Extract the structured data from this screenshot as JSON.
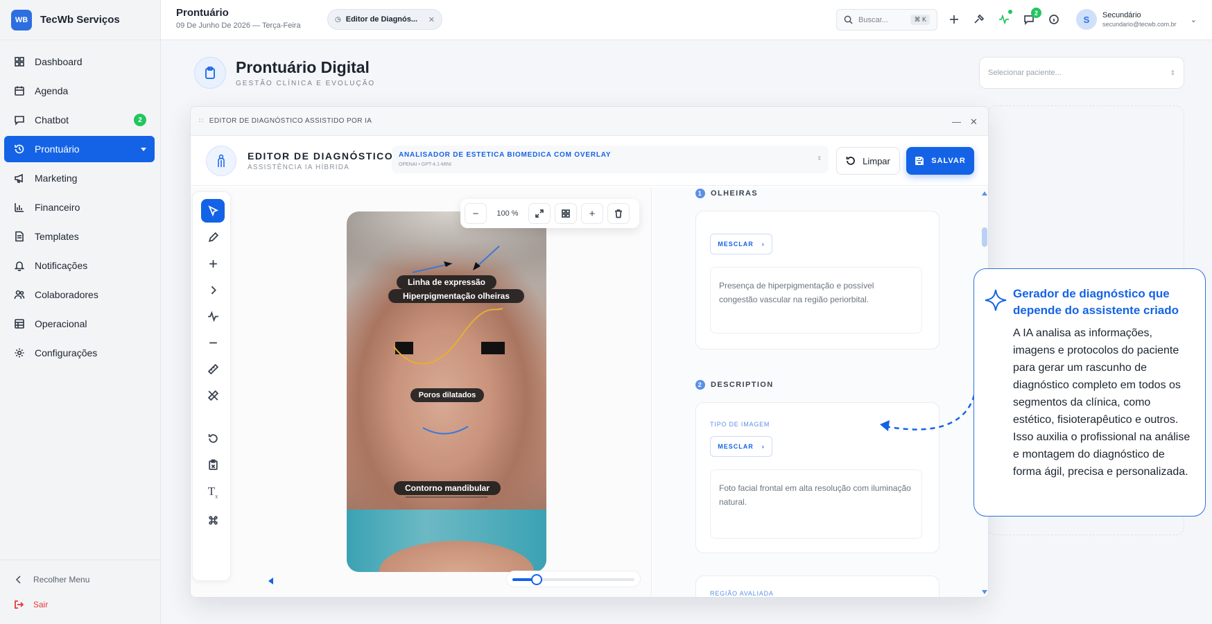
{
  "brand": {
    "logo": "WB",
    "name": "TecWb Serviços"
  },
  "sidebar": {
    "items": [
      {
        "label": "Dashboard",
        "icon": "dashboard-icon"
      },
      {
        "label": "Agenda",
        "icon": "calendar-icon"
      },
      {
        "label": "Chatbot",
        "icon": "chat-icon",
        "badge": "2"
      },
      {
        "label": "Prontuário",
        "icon": "history-icon",
        "active": true
      },
      {
        "label": "Marketing",
        "icon": "megaphone-icon"
      },
      {
        "label": "Financeiro",
        "icon": "bar-chart-icon"
      },
      {
        "label": "Templates",
        "icon": "document-icon"
      },
      {
        "label": "Notificações",
        "icon": "bell-icon"
      },
      {
        "label": "Colaboradores",
        "icon": "users-icon"
      },
      {
        "label": "Operacional",
        "icon": "table-icon"
      },
      {
        "label": "Configurações",
        "icon": "gear-icon"
      }
    ],
    "collapse_label": "Recolher Menu",
    "exit_label": "Sair"
  },
  "topbar": {
    "title": "Prontuário",
    "date": "09 De Junho De 2026 — Terça-Feira",
    "tab_label": "Editor de Diagnós...",
    "search_placeholder": "Buscar...",
    "search_shortcut": "⌘ K",
    "notifications_badge": "2",
    "user_initial": "S",
    "user_name": "Secundário",
    "user_email": "secundario@tecwb.com.br"
  },
  "main": {
    "title": "Prontuário Digital",
    "subtitle": "GESTÃO CLÍNICA E EVOLUÇÃO",
    "patient_placeholder": "Selecionar paciente..."
  },
  "editor": {
    "window_title": "EDITOR DE DIAGNÓSTICO ASSISTIDO POR IA",
    "title": "EDITOR DE DIAGNÓSTICO",
    "subtitle": "ASSISTÊNCIA IA HÍBRIDA",
    "model_name": "ANALISADOR DE ESTETICA BIOMEDICA COM OVERLAY",
    "model_provider": "OPENAI • GPT-4.1-MINI",
    "clear_label": "Limpar",
    "save_label": "SALVAR",
    "zoom": "100 %",
    "timeline_progress": 0.2,
    "photo_labels": [
      "Linha de expressão",
      "Hiperpigmentação olheiras",
      "Poros dilatados",
      "Contorno mandibular"
    ],
    "sections": [
      {
        "num": "1",
        "title": "OLHEIRAS",
        "merge": "MESCLAR",
        "text": "Presença de hiperpigmentação e possível congestão vascular na região periorbital."
      },
      {
        "num": "2",
        "title": "DESCRIPTION",
        "field_label": "TIPO DE IMAGEM",
        "merge": "MESCLAR",
        "text": "Foto facial frontal em alta resolução com iluminação natural."
      }
    ],
    "next_field_label": "REGIÃO AVALIADA"
  },
  "callout": {
    "title": "Gerador de diagnóstico que depende do assistente criado",
    "body": "A IA analisa as informações, imagens e protocolos do paciente para gerar um rascunho de diagnóstico completo em todos os segmentos da clínica, como estético, fisioterapêutico e outros. Isso auxilia o profissional na análise e montagem do diagnóstico de forma ágil, precisa e personalizada."
  },
  "colors": {
    "accent": "#1463e6",
    "badge": "#22c55e",
    "exit": "#e53935"
  }
}
